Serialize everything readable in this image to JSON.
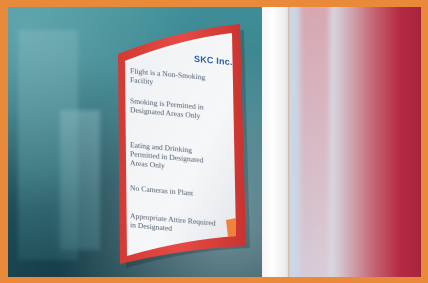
{
  "sign": {
    "logo": "SKC Inc.",
    "rules": [
      "Flight is a Non-Smoking Facility",
      "Smoking is Permitted in Designated Areas Only",
      "Eating and Drinking Permitted in Designated Areas Only",
      "No Cameras in Plant",
      "Appropriate Attire Required in Designated"
    ]
  },
  "colors": {
    "border_orange": "#e9893a",
    "sign_frame_red": "#e0443f",
    "glass_teal": "#3b7f89",
    "logo_blue": "#2a5fa5",
    "right_red": "#b42a42"
  }
}
